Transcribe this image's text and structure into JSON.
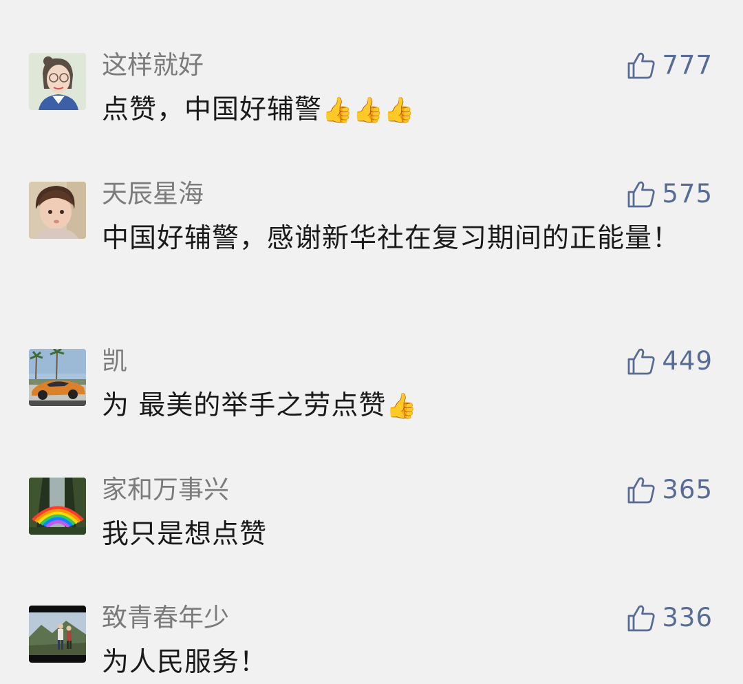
{
  "colors": {
    "background": "#f1f1f1",
    "name": "#7b7b7b",
    "text": "#1a1a1a",
    "like": "#576b95"
  },
  "comments": [
    {
      "name": "这样就好",
      "text": "点赞，中国好辅警",
      "emoji": "👍👍👍",
      "likes": "777",
      "avatar": "cartoon-woman-avatar"
    },
    {
      "name": "天辰星海",
      "text": "中国好辅警，感谢新华社在复习期间的正能量！",
      "emoji": "",
      "likes": "575",
      "avatar": "toddler-photo-avatar"
    },
    {
      "name": "凯",
      "text": "为 最美的举手之劳点赞",
      "emoji": "👍",
      "likes": "449",
      "avatar": "sports-car-avatar"
    },
    {
      "name": "家和万事兴",
      "text": "我只是想点赞",
      "emoji": "",
      "likes": "365",
      "avatar": "rainbow-waterfall-avatar"
    },
    {
      "name": "致青春年少",
      "text": "为人民服务！",
      "emoji": "",
      "likes": "336",
      "avatar": "couple-mountain-avatar"
    }
  ]
}
